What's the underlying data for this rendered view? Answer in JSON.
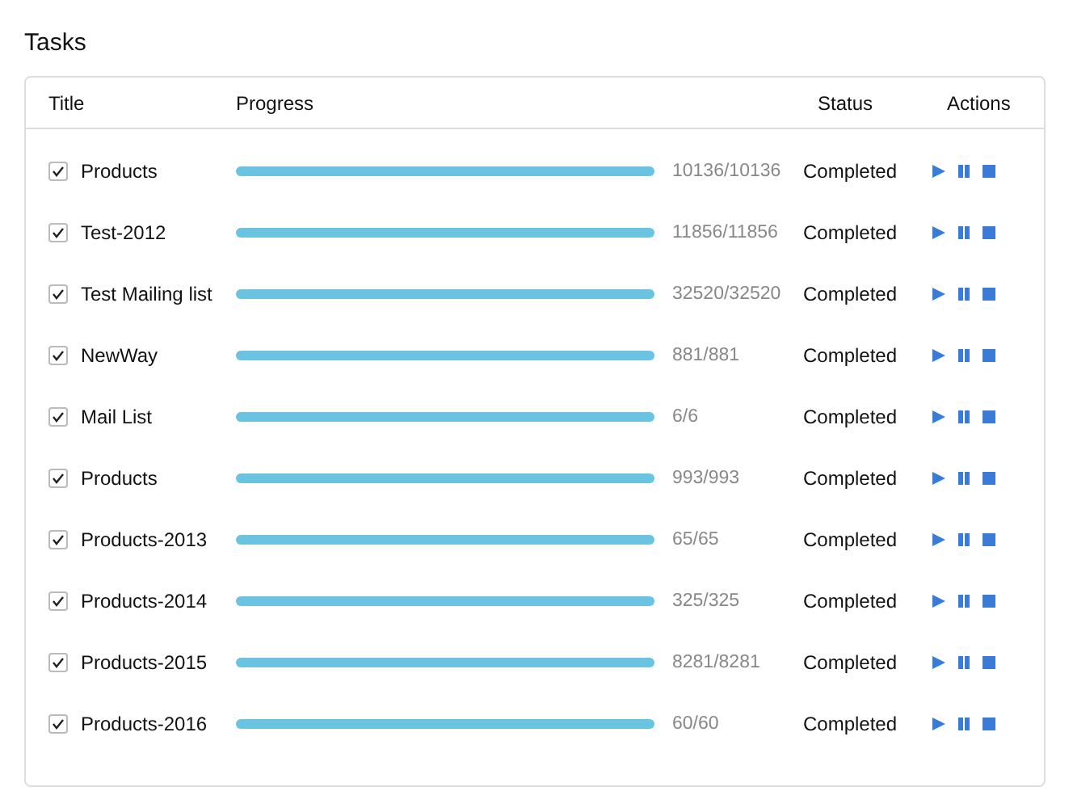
{
  "title": "Tasks",
  "table": {
    "columns": [
      "Title",
      "Progress",
      "Status",
      "Actions"
    ],
    "rows": [
      {
        "checked": true,
        "title": "Products",
        "level": 1,
        "reading": "10136/10136",
        "status": "Completed"
      },
      {
        "checked": true,
        "title": "Test-2012",
        "level": 1,
        "reading": "11856/11856",
        "status": "Completed"
      },
      {
        "checked": true,
        "title": "Test Mailing list",
        "level": 1,
        "reading": "32520/32520",
        "status": "Completed"
      },
      {
        "checked": true,
        "title": "NewWay",
        "level": 1,
        "reading": "881/881",
        "status": "Completed"
      },
      {
        "checked": true,
        "title": "Mail List",
        "level": 1,
        "reading": "6/6",
        "status": "Completed"
      },
      {
        "checked": true,
        "title": "Products",
        "level": 1,
        "reading": "993/993",
        "status": "Completed"
      },
      {
        "checked": true,
        "title": "Products-2013",
        "level": 1,
        "reading": "65/65",
        "status": "Completed"
      },
      {
        "checked": true,
        "title": "Products-2014",
        "level": 1,
        "reading": "325/325",
        "status": "Completed"
      },
      {
        "checked": true,
        "title": "Products-2015",
        "level": 1,
        "reading": "8281/8281",
        "status": "Completed"
      },
      {
        "checked": true,
        "title": "Products-2016",
        "level": 1,
        "reading": "60/60",
        "status": "Completed"
      }
    ]
  }
}
